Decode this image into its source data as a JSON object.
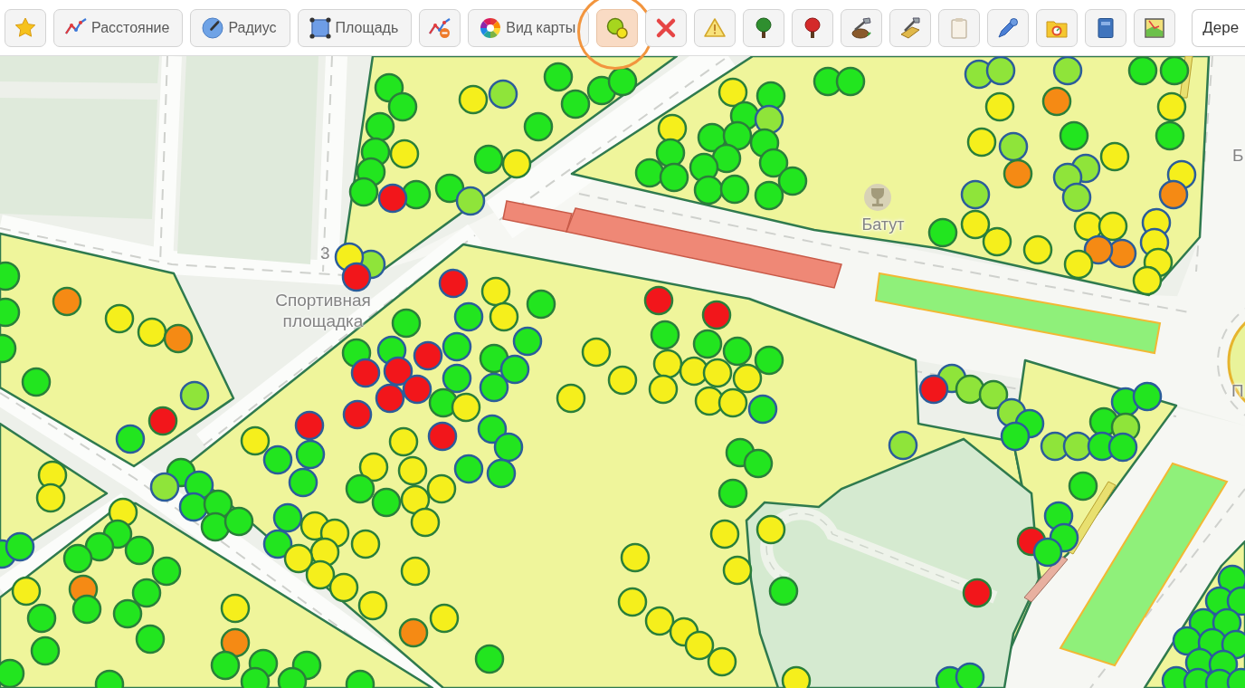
{
  "toolbar": {
    "buttons": [
      {
        "active": false,
        "clicked": false
      },
      {
        "label": "Расстояние",
        "active": false,
        "clicked": false
      },
      {
        "label": "Радиус",
        "active": false,
        "clicked": false
      },
      {
        "label": "Площадь",
        "active": false,
        "clicked": false
      },
      {
        "active": false,
        "clicked": false
      },
      {
        "label": "Вид карты",
        "active": false,
        "clicked": false
      },
      {
        "active": true,
        "clicked": true
      },
      {
        "active": false,
        "clicked": false
      },
      {
        "active": false,
        "clicked": false
      },
      {
        "active": false,
        "clicked": false
      },
      {
        "active": false,
        "clicked": false
      },
      {
        "active": false,
        "clicked": false
      },
      {
        "active": false,
        "clicked": false
      },
      {
        "active": false,
        "clicked": false
      },
      {
        "active": false,
        "clicked": false
      },
      {
        "active": false,
        "clicked": false
      },
      {
        "active": false,
        "clicked": false
      },
      {
        "active": false,
        "clicked": false
      }
    ],
    "search": {
      "value": "Дере"
    }
  },
  "map": {
    "house_number": "3",
    "place_labels": [
      "Спортивная площадка",
      "Б",
      "П"
    ],
    "poi": {
      "label": "Батут"
    },
    "markers": [
      {
        "color": "#22e51f",
        "kind": "plain"
      },
      {
        "color": "#22e51f",
        "kind": "plain"
      },
      {
        "color": "#22e51f",
        "kind": "plain"
      },
      {
        "color": "#22e51f",
        "kind": "plain"
      },
      {
        "color": "#f5ef1c",
        "kind": "plain"
      },
      {
        "color": "#22e51f",
        "kind": "plain"
      },
      {
        "color": "#22e51f",
        "kind": "plain"
      },
      {
        "color": "#22e51f",
        "kind": "plain"
      },
      {
        "color": "#f2161b",
        "kind": "ringed"
      },
      {
        "color": "#22e51f",
        "kind": "plain"
      },
      {
        "color": "#8fe43a",
        "kind": "ringed"
      },
      {
        "color": "#f5ef1c",
        "kind": "plain"
      },
      {
        "color": "#8fe43a",
        "kind": "ringed"
      },
      {
        "color": "#22e51f",
        "kind": "plain"
      },
      {
        "color": "#22e51f",
        "kind": "plain"
      },
      {
        "color": "#22e51f",
        "kind": "plain"
      },
      {
        "color": "#22e51f",
        "kind": "plain"
      },
      {
        "color": "#22e51f",
        "kind": "plain"
      },
      {
        "color": "#22e51f",
        "kind": "plain"
      },
      {
        "color": "#f5ef1c",
        "kind": "plain"
      },
      {
        "color": "#8fe43a",
        "kind": "ringed"
      },
      {
        "color": "#f5ef1c",
        "kind": "ringed"
      },
      {
        "color": "#f2161b",
        "kind": "ringed"
      },
      {
        "color": "#f5ef1c",
        "kind": "plain"
      },
      {
        "color": "#22e51f",
        "kind": "plain"
      },
      {
        "color": "#22e51f",
        "kind": "plain"
      },
      {
        "color": "#8fe43a",
        "kind": "ringed"
      },
      {
        "color": "#f5ef1c",
        "kind": "plain"
      },
      {
        "color": "#22e51f",
        "kind": "plain"
      },
      {
        "color": "#22e51f",
        "kind": "plain"
      },
      {
        "color": "#22e51f",
        "kind": "plain"
      },
      {
        "color": "#22e51f",
        "kind": "plain"
      },
      {
        "color": "#22e51f",
        "kind": "plain"
      },
      {
        "color": "#22e51f",
        "kind": "plain"
      },
      {
        "color": "#22e51f",
        "kind": "plain"
      },
      {
        "color": "#22e51f",
        "kind": "plain"
      },
      {
        "color": "#22e51f",
        "kind": "plain"
      },
      {
        "color": "#22e51f",
        "kind": "plain"
      },
      {
        "color": "#22e51f",
        "kind": "plain"
      },
      {
        "color": "#22e51f",
        "kind": "plain"
      },
      {
        "color": "#22e51f",
        "kind": "plain"
      },
      {
        "color": "#22e51f",
        "kind": "plain"
      },
      {
        "color": "#22e51f",
        "kind": "plain"
      },
      {
        "color": "#8fe43a",
        "kind": "ringed"
      },
      {
        "color": "#8fe43a",
        "kind": "ringed"
      },
      {
        "color": "#8fe43a",
        "kind": "ringed"
      },
      {
        "color": "#22e51f",
        "kind": "plain"
      },
      {
        "color": "#22e51f",
        "kind": "plain"
      },
      {
        "color": "#f58a14",
        "kind": "plain"
      },
      {
        "color": "#f5ef1c",
        "kind": "plain"
      },
      {
        "color": "#f5ef1c",
        "kind": "plain"
      },
      {
        "color": "#22e51f",
        "kind": "plain"
      },
      {
        "color": "#22e51f",
        "kind": "plain"
      },
      {
        "color": "#f5ef1c",
        "kind": "plain"
      },
      {
        "color": "#8fe43a",
        "kind": "ringed"
      },
      {
        "color": "#f5ef1c",
        "kind": "plain"
      },
      {
        "color": "#f58a14",
        "kind": "plain"
      },
      {
        "color": "#8fe43a",
        "kind": "ringed"
      },
      {
        "color": "#8fe43a",
        "kind": "ringed"
      },
      {
        "color": "#8fe43a",
        "kind": "ringed"
      },
      {
        "color": "#f5ef1c",
        "kind": "ringed"
      },
      {
        "color": "#f58a14",
        "kind": "ringed"
      },
      {
        "color": "#8fe43a",
        "kind": "ringed"
      },
      {
        "color": "#f5ef1c",
        "kind": "plain"
      },
      {
        "color": "#22e51f",
        "kind": "plain"
      },
      {
        "color": "#f5ef1c",
        "kind": "plain"
      },
      {
        "color": "#f5ef1c",
        "kind": "plain"
      },
      {
        "color": "#f5ef1c",
        "kind": "plain"
      },
      {
        "color": "#f5ef1c",
        "kind": "plain"
      },
      {
        "color": "#f58a14",
        "kind": "ringed"
      },
      {
        "color": "#f58a14",
        "kind": "ringed"
      },
      {
        "color": "#f5ef1c",
        "kind": "plain"
      },
      {
        "color": "#f5ef1c",
        "kind": "ringed"
      },
      {
        "color": "#f5ef1c",
        "kind": "ringed"
      },
      {
        "color": "#f5ef1c",
        "kind": "plain"
      },
      {
        "color": "#f5ef1c",
        "kind": "plain"
      },
      {
        "color": "#22e51f",
        "kind": "plain"
      },
      {
        "color": "#22e51f",
        "kind": "plain"
      },
      {
        "color": "#22e51f",
        "kind": "plain"
      },
      {
        "color": "#f58a14",
        "kind": "plain"
      },
      {
        "color": "#f5ef1c",
        "kind": "plain"
      },
      {
        "color": "#f5ef1c",
        "kind": "plain"
      },
      {
        "color": "#f58a14",
        "kind": "plain"
      },
      {
        "color": "#22e51f",
        "kind": "plain"
      },
      {
        "color": "#8fe43a",
        "kind": "ringed"
      },
      {
        "color": "#f2161b",
        "kind": "plain"
      },
      {
        "color": "#22e51f",
        "kind": "ringed"
      },
      {
        "color": "#f5ef1c",
        "kind": "plain"
      },
      {
        "color": "#f5ef1c",
        "kind": "plain"
      },
      {
        "color": "#22e51f",
        "kind": "ringed"
      },
      {
        "color": "#22e51f",
        "kind": "ringed"
      },
      {
        "color": "#f2161b",
        "kind": "ringed"
      },
      {
        "color": "#f5ef1c",
        "kind": "plain"
      },
      {
        "color": "#22e51f",
        "kind": "plain"
      },
      {
        "color": "#22e51f",
        "kind": "plain"
      },
      {
        "color": "#22e51f",
        "kind": "ringed"
      },
      {
        "color": "#f5ef1c",
        "kind": "plain"
      },
      {
        "color": "#22e51f",
        "kind": "ringed"
      },
      {
        "color": "#22e51f",
        "kind": "ringed"
      },
      {
        "color": "#f2161b",
        "kind": "ringed"
      },
      {
        "color": "#22e51f",
        "kind": "ringed"
      },
      {
        "color": "#22e51f",
        "kind": "plain"
      },
      {
        "color": "#f2161b",
        "kind": "ringed"
      },
      {
        "color": "#f2161b",
        "kind": "ringed"
      },
      {
        "color": "#f2161b",
        "kind": "ringed"
      },
      {
        "color": "#f2161b",
        "kind": "ringed"
      },
      {
        "color": "#22e51f",
        "kind": "ringed"
      },
      {
        "color": "#22e51f",
        "kind": "plain"
      },
      {
        "color": "#22e51f",
        "kind": "ringed"
      },
      {
        "color": "#22e51f",
        "kind": "ringed"
      },
      {
        "color": "#22e51f",
        "kind": "plain"
      },
      {
        "color": "#f5ef1c",
        "kind": "plain"
      },
      {
        "color": "#f2161b",
        "kind": "ringed"
      },
      {
        "color": "#f2161b",
        "kind": "ringed"
      },
      {
        "color": "#f2161b",
        "kind": "ringed"
      },
      {
        "color": "#22e51f",
        "kind": "ringed"
      },
      {
        "color": "#22e51f",
        "kind": "ringed"
      },
      {
        "color": "#f5ef1c",
        "kind": "plain"
      },
      {
        "color": "#f5ef1c",
        "kind": "plain"
      },
      {
        "color": "#22e51f",
        "kind": "ringed"
      },
      {
        "color": "#22e51f",
        "kind": "ringed"
      },
      {
        "color": "#22e51f",
        "kind": "ringed"
      },
      {
        "color": "#f5ef1c",
        "kind": "plain"
      },
      {
        "color": "#f5ef1c",
        "kind": "plain"
      },
      {
        "color": "#22e51f",
        "kind": "ringed"
      },
      {
        "color": "#22e51f",
        "kind": "ringed"
      },
      {
        "color": "#f5ef1c",
        "kind": "plain"
      },
      {
        "color": "#22e51f",
        "kind": "plain"
      },
      {
        "color": "#22e51f",
        "kind": "plain"
      },
      {
        "color": "#f5ef1c",
        "kind": "plain"
      },
      {
        "color": "#f5ef1c",
        "kind": "plain"
      },
      {
        "color": "#22e51f",
        "kind": "ringed"
      },
      {
        "color": "#f5ef1c",
        "kind": "plain"
      },
      {
        "color": "#f5ef1c",
        "kind": "plain"
      },
      {
        "color": "#22e51f",
        "kind": "ringed"
      },
      {
        "color": "#f5ef1c",
        "kind": "plain"
      },
      {
        "color": "#f5ef1c",
        "kind": "plain"
      },
      {
        "color": "#f5ef1c",
        "kind": "plain"
      },
      {
        "color": "#f5ef1c",
        "kind": "plain"
      },
      {
        "color": "#f5ef1c",
        "kind": "plain"
      },
      {
        "color": "#f5ef1c",
        "kind": "plain"
      },
      {
        "color": "#f5ef1c",
        "kind": "plain"
      },
      {
        "color": "#f5ef1c",
        "kind": "plain"
      },
      {
        "color": "#f58a14",
        "kind": "plain"
      },
      {
        "color": "#22e51f",
        "kind": "plain"
      },
      {
        "color": "#f5ef1c",
        "kind": "plain"
      },
      {
        "color": "#f5ef1c",
        "kind": "plain"
      },
      {
        "color": "#f5ef1c",
        "kind": "plain"
      },
      {
        "color": "#f2161b",
        "kind": "plain"
      },
      {
        "color": "#f2161b",
        "kind": "plain"
      },
      {
        "color": "#22e51f",
        "kind": "plain"
      },
      {
        "color": "#22e51f",
        "kind": "plain"
      },
      {
        "color": "#22e51f",
        "kind": "plain"
      },
      {
        "color": "#22e51f",
        "kind": "plain"
      },
      {
        "color": "#f5ef1c",
        "kind": "plain"
      },
      {
        "color": "#f5ef1c",
        "kind": "plain"
      },
      {
        "color": "#f5ef1c",
        "kind": "plain"
      },
      {
        "color": "#f5ef1c",
        "kind": "plain"
      },
      {
        "color": "#f5ef1c",
        "kind": "plain"
      },
      {
        "color": "#f5ef1c",
        "kind": "plain"
      },
      {
        "color": "#f5ef1c",
        "kind": "plain"
      },
      {
        "color": "#22e51f",
        "kind": "ringed"
      },
      {
        "color": "#22e51f",
        "kind": "plain"
      },
      {
        "color": "#22e51f",
        "kind": "plain"
      },
      {
        "color": "#22e51f",
        "kind": "plain"
      },
      {
        "color": "#f5ef1c",
        "kind": "plain"
      },
      {
        "color": "#f5ef1c",
        "kind": "plain"
      },
      {
        "color": "#f5ef1c",
        "kind": "plain"
      },
      {
        "color": "#f5ef1c",
        "kind": "plain"
      },
      {
        "color": "#22e51f",
        "kind": "plain"
      },
      {
        "color": "#f5ef1c",
        "kind": "plain"
      },
      {
        "color": "#f5ef1c",
        "kind": "plain"
      },
      {
        "color": "#f5ef1c",
        "kind": "plain"
      },
      {
        "color": "#f5ef1c",
        "kind": "plain"
      },
      {
        "color": "#f5ef1c",
        "kind": "plain"
      },
      {
        "color": "#f5ef1c",
        "kind": "plain"
      },
      {
        "color": "#22e51f",
        "kind": "plain"
      },
      {
        "color": "#8fe43a",
        "kind": "ringed"
      },
      {
        "color": "#22e51f",
        "kind": "ringed"
      },
      {
        "color": "#22e51f",
        "kind": "ringed"
      },
      {
        "color": "#22e51f",
        "kind": "plain"
      },
      {
        "color": "#22e51f",
        "kind": "plain"
      },
      {
        "color": "#22e51f",
        "kind": "plain"
      },
      {
        "color": "#f5ef1c",
        "kind": "plain"
      },
      {
        "color": "#22e51f",
        "kind": "plain"
      },
      {
        "color": "#22e51f",
        "kind": "plain"
      },
      {
        "color": "#22e51f",
        "kind": "plain"
      },
      {
        "color": "#22e51f",
        "kind": "plain"
      },
      {
        "color": "#22e51f",
        "kind": "plain"
      },
      {
        "color": "#f5ef1c",
        "kind": "plain"
      },
      {
        "color": "#f58a14",
        "kind": "plain"
      },
      {
        "color": "#22e51f",
        "kind": "plain"
      },
      {
        "color": "#22e51f",
        "kind": "plain"
      },
      {
        "color": "#22e51f",
        "kind": "plain"
      },
      {
        "color": "#22e51f",
        "kind": "plain"
      },
      {
        "color": "#22e51f",
        "kind": "plain"
      },
      {
        "color": "#22e51f",
        "kind": "plain"
      },
      {
        "color": "#22e51f",
        "kind": "plain"
      },
      {
        "color": "#22e51f",
        "kind": "plain"
      },
      {
        "color": "#f5ef1c",
        "kind": "plain"
      },
      {
        "color": "#f58a14",
        "kind": "plain"
      },
      {
        "color": "#22e51f",
        "kind": "plain"
      },
      {
        "color": "#22e51f",
        "kind": "plain"
      },
      {
        "color": "#22e51f",
        "kind": "plain"
      },
      {
        "color": "#22e51f",
        "kind": "plain"
      },
      {
        "color": "#22e51f",
        "kind": "plain"
      },
      {
        "color": "#22e51f",
        "kind": "plain"
      },
      {
        "color": "#8fe43a",
        "kind": "ringed"
      },
      {
        "color": "#8fe43a",
        "kind": "ringed"
      },
      {
        "color": "#f2161b",
        "kind": "ringed"
      },
      {
        "color": "#8fe43a",
        "kind": "plain"
      },
      {
        "color": "#8fe43a",
        "kind": "plain"
      },
      {
        "color": "#8fe43a",
        "kind": "ringed"
      },
      {
        "color": "#22e51f",
        "kind": "ringed"
      },
      {
        "color": "#22e51f",
        "kind": "ringed"
      },
      {
        "color": "#22e51f",
        "kind": "ringed"
      },
      {
        "color": "#22e51f",
        "kind": "ringed"
      },
      {
        "color": "#22e51f",
        "kind": "plain"
      },
      {
        "color": "#8fe43a",
        "kind": "plain"
      },
      {
        "color": "#8fe43a",
        "kind": "ringed"
      },
      {
        "color": "#8fe43a",
        "kind": "ringed"
      },
      {
        "color": "#22e51f",
        "kind": "ringed"
      },
      {
        "color": "#22e51f",
        "kind": "ringed"
      },
      {
        "color": "#22e51f",
        "kind": "plain"
      },
      {
        "color": "#22e51f",
        "kind": "ringed"
      },
      {
        "color": "#22e51f",
        "kind": "ringed"
      },
      {
        "color": "#f2161b",
        "kind": "plain"
      },
      {
        "color": "#22e51f",
        "kind": "ringed"
      },
      {
        "color": "#f2161b",
        "kind": "plain"
      },
      {
        "color": "#22e51f",
        "kind": "ringed"
      },
      {
        "color": "#22e51f",
        "kind": "ringed"
      },
      {
        "color": "#22e51f",
        "kind": "ringed"
      },
      {
        "color": "#22e51f",
        "kind": "ringed"
      },
      {
        "color": "#22e51f",
        "kind": "ringed"
      },
      {
        "color": "#22e51f",
        "kind": "ringed"
      },
      {
        "color": "#22e51f",
        "kind": "ringed"
      },
      {
        "color": "#22e51f",
        "kind": "ringed"
      },
      {
        "color": "#22e51f",
        "kind": "ringed"
      },
      {
        "color": "#22e51f",
        "kind": "ringed"
      },
      {
        "color": "#22e51f",
        "kind": "ringed"
      },
      {
        "color": "#22e51f",
        "kind": "ringed"
      },
      {
        "color": "#22e51f",
        "kind": "ringed"
      },
      {
        "color": "#22e51f",
        "kind": "ringed"
      },
      {
        "color": "#22e51f",
        "kind": "ringed"
      },
      {
        "color": "#22e51f",
        "kind": "ringed"
      }
    ]
  }
}
